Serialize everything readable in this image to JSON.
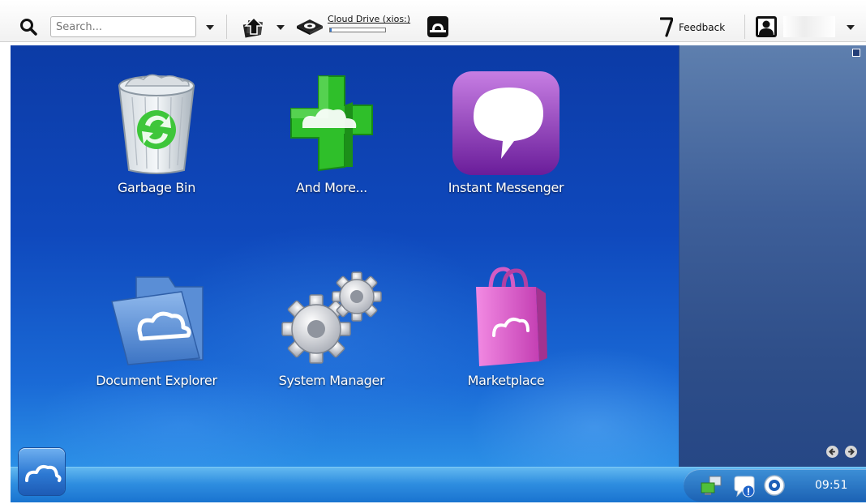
{
  "toolbar": {
    "search": {
      "placeholder": "Search...",
      "value": ""
    },
    "cloud_drive": {
      "label": "Cloud Drive (xios:)",
      "usage_fraction": 0.03
    },
    "feedback": {
      "label": "Feedback"
    },
    "icons": [
      "search-icon",
      "share-upload-icon",
      "drive-icon",
      "fullscreen-icon",
      "feedback-icon",
      "user-avatar-icon"
    ]
  },
  "desktop": {
    "apps": [
      {
        "label": "Garbage Bin",
        "icon": "garbage-bin-icon"
      },
      {
        "label": "And More...",
        "icon": "plus-icon"
      },
      {
        "label": "Instant Messenger",
        "icon": "messenger-icon"
      },
      {
        "label": "Document Explorer",
        "icon": "folder-icon"
      },
      {
        "label": "System Manager",
        "icon": "gears-icon"
      },
      {
        "label": "Marketplace",
        "icon": "shopping-bag-icon"
      }
    ]
  },
  "taskbar": {
    "clock": "09:51",
    "tray_icons": [
      "network-icon",
      "notification-icon",
      "settings-icon"
    ]
  },
  "colors": {
    "desktop_blue": "#0f49bd",
    "taskbar_blue": "#2f8ee0",
    "plus_green": "#2fbf2a",
    "messenger_purple": "#9b3fc4",
    "bag_pink": "#e25fcf"
  }
}
